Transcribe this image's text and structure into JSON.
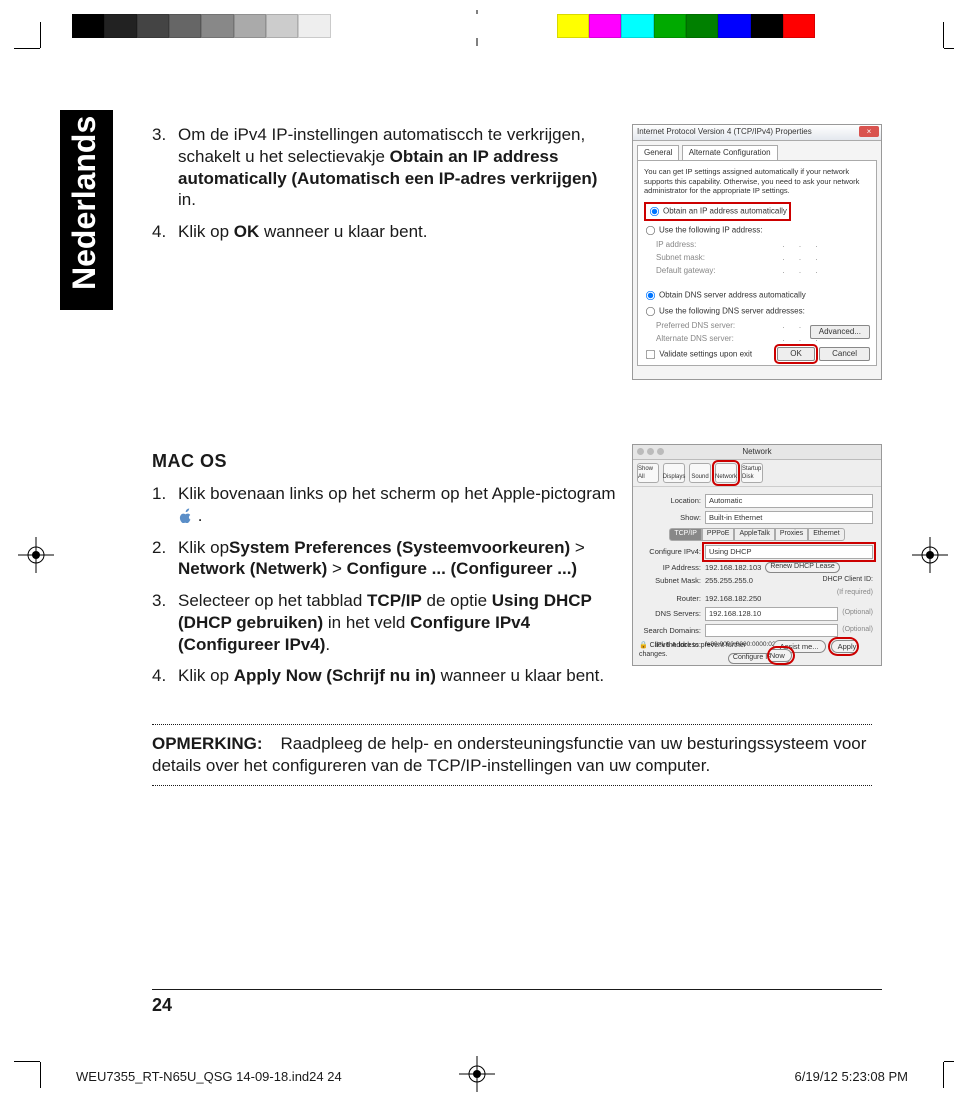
{
  "language_tab": "Nederlands",
  "section1": {
    "step3": {
      "num": "3.",
      "text_a": "Om de iPv4 IP-instellingen automatiscch te verkrijgen, schakelt u het selectievakje ",
      "bold": "Obtain an IP address automatically (Automatisch een IP-adres verkrijgen)",
      "text_b": " in."
    },
    "step4": {
      "num": "4.",
      "text_a": "Klik op ",
      "bold": "OK",
      "text_b": " wanneer u klaar bent."
    }
  },
  "win_dialog": {
    "title": "Internet Protocol Version 4 (TCP/IPv4) Properties",
    "tab_general": "General",
    "tab_alt": "Alternate Configuration",
    "desc": "You can get IP settings assigned automatically if your network supports this capability. Otherwise, you need to ask your network administrator for the appropriate IP settings.",
    "r_auto_ip": "Obtain an IP address automatically",
    "r_use_ip": "Use the following IP address:",
    "f_ip": "IP address:",
    "f_mask": "Subnet mask:",
    "f_gw": "Default gateway:",
    "r_auto_dns": "Obtain DNS server address automatically",
    "r_use_dns": "Use the following DNS server addresses:",
    "f_dns1": "Preferred DNS server:",
    "f_dns2": "Alternate DNS server:",
    "chk_validate": "Validate settings upon exit",
    "btn_adv": "Advanced...",
    "btn_ok": "OK",
    "btn_cancel": "Cancel"
  },
  "section2": {
    "heading": "MAC OS",
    "step1": {
      "num": "1.",
      "text": "Klik bovenaan links op het scherm op het Apple-pictogram ",
      "tail": " ."
    },
    "step2": {
      "num": "2.",
      "a": "Klik op",
      "b1": "System Preferences (Systeemvoorkeuren)",
      "sep1": " > ",
      "b2": "Network (Netwerk)",
      "sep2": " > ",
      "b3": "Configure ... (Configureer ...)"
    },
    "step3": {
      "num": "3.",
      "a": "Selecteer op het tabblad ",
      "b1": "TCP/IP",
      "mid": " de optie ",
      "b2": "Using DHCP (DHCP gebruiken)",
      "mid2": " in het veld ",
      "b3": "Configure IPv4 (Configureer IPv4)",
      "tail": "."
    },
    "step4": {
      "num": "4.",
      "a": "Klik op ",
      "b": "Apply Now (Schrijf nu in)",
      "tail": " wanneer u klaar bent."
    }
  },
  "mac_dialog": {
    "title": "Network",
    "tb": [
      "Show All",
      "Displays",
      "Sound",
      "Network",
      "Startup Disk"
    ],
    "loc_lab": "Location:",
    "loc_val": "Automatic",
    "show_lab": "Show:",
    "show_val": "Built-in Ethernet",
    "tabs": [
      "TCP/IP",
      "PPPoE",
      "AppleTalk",
      "Proxies",
      "Ethernet"
    ],
    "cfg_lab": "Configure IPv4:",
    "cfg_val": "Using DHCP",
    "ip_lab": "IP Address:",
    "ip_val": "192.168.182.103",
    "renew": "Renew DHCP Lease",
    "mask_lab": "Subnet Mask:",
    "mask_val": "255.255.255.0",
    "cid_lab": "DHCP Client ID:",
    "cid_hint": "(If required)",
    "router_lab": "Router:",
    "router_val": "192.168.182.250",
    "dns_lab": "DNS Servers:",
    "dns_val": "192.168.128.10",
    "optional": "(Optional)",
    "sd_lab": "Search Domains:",
    "v6_lab": "IPv6 Address:",
    "v6_val": "fe80:0000:0000:0000:0211:24ff:fe32:b18e",
    "cfg6_btn": "Configure IPv6...",
    "lock_txt": "Click the lock to prevent further changes.",
    "assist": "Assist me...",
    "apply": "Apply Now"
  },
  "note": {
    "label": "OPMERKING:",
    "text": "Raadpleeg de help- en ondersteuningsfunctie van uw besturingssysteem voor details over het configureren van de TCP/IP-instellingen van uw computer."
  },
  "page_number": "24",
  "footer": {
    "file": "WEU7355_RT-N65U_QSG 14-09-18.ind24   24",
    "date": "6/19/12   5:23:08 PM"
  },
  "colorbar_left": [
    "#000",
    "#222",
    "#444",
    "#666",
    "#888",
    "#aaa",
    "#ccc",
    "#eee",
    "#fff",
    "#fff",
    "#fff",
    "#fff",
    "#fff"
  ],
  "colorbar_right": [
    "#fff",
    "#fff",
    "#ff0",
    "#f0f",
    "#0ff",
    "#0a0",
    "#008000",
    "#00f",
    "#000",
    "#f00",
    "#fff",
    "#fff",
    "#fff"
  ]
}
